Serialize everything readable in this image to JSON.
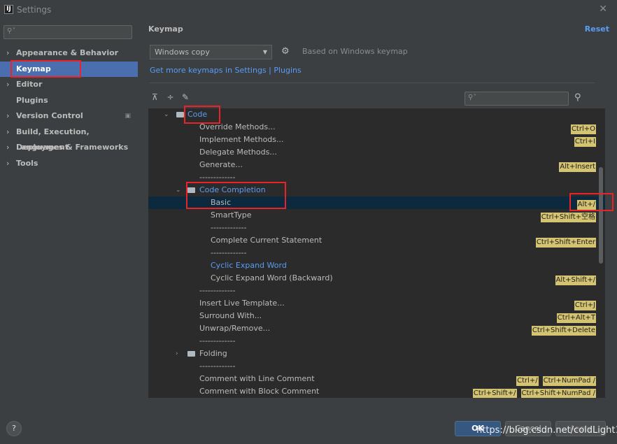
{
  "window": {
    "title": "Settings",
    "logo_letter": "IJ"
  },
  "sidebar": {
    "items": [
      {
        "label": "Appearance & Behavior",
        "expandable": true
      },
      {
        "label": "Keymap",
        "expandable": false
      },
      {
        "label": "Editor",
        "expandable": true
      },
      {
        "label": "Plugins",
        "expandable": false
      },
      {
        "label": "Version Control",
        "expandable": true
      },
      {
        "label": "Build, Execution, Deployment",
        "expandable": true
      },
      {
        "label": "Languages & Frameworks",
        "expandable": true
      },
      {
        "label": "Tools",
        "expandable": true
      }
    ]
  },
  "header": {
    "title": "Keymap",
    "reset": "Reset"
  },
  "keymap": {
    "selected": "Windows copy",
    "based_on": "Based on Windows keymap",
    "more_link": "Get more keymaps in Settings | Plugins"
  },
  "tree": {
    "separator": "-------------",
    "rows": {
      "code": "Code",
      "override": {
        "label": "Override Methods...",
        "shortcuts": [
          "Ctrl+O"
        ]
      },
      "implement": {
        "label": "Implement Methods...",
        "shortcuts": [
          "Ctrl+I"
        ]
      },
      "delegate": {
        "label": "Delegate Methods..."
      },
      "generate": {
        "label": "Generate...",
        "shortcuts": [
          "Alt+Insert"
        ]
      },
      "code_completion": "Code Completion",
      "basic": {
        "label": "Basic",
        "shortcuts": [
          "Alt+/"
        ]
      },
      "smarttype": {
        "label": "SmartType",
        "shortcuts": [
          "Ctrl+Shift+空格"
        ]
      },
      "complete_stmt": {
        "label": "Complete Current Statement",
        "shortcuts": [
          "Ctrl+Shift+Enter"
        ]
      },
      "cyclic": {
        "label": "Cyclic Expand Word"
      },
      "cyclic_back": {
        "label": "Cyclic Expand Word (Backward)",
        "shortcuts": [
          "Alt+Shift+/"
        ]
      },
      "live_template": {
        "label": "Insert Live Template...",
        "shortcuts": [
          "Ctrl+J"
        ]
      },
      "surround": {
        "label": "Surround With...",
        "shortcuts": [
          "Ctrl+Alt+T"
        ]
      },
      "unwrap": {
        "label": "Unwrap/Remove...",
        "shortcuts": [
          "Ctrl+Shift+Delete"
        ]
      },
      "folding": "Folding",
      "line_comment": {
        "label": "Comment with Line Comment",
        "shortcuts": [
          "Ctrl+/",
          "Ctrl+NumPad /"
        ]
      },
      "block_comment": {
        "label": "Comment with Block Comment",
        "shortcuts": [
          "Ctrl+Shift+/",
          "Ctrl+Shift+NumPad /"
        ]
      }
    }
  },
  "buttons": {
    "help": "?",
    "ok": "OK",
    "cancel": "Cancel",
    "apply": "Apply"
  },
  "watermark": "https://blog.csdn.net/coldLight1",
  "colors": {
    "accent": "#589df6",
    "selection": "#4b6eaf",
    "highlight_box": "#e8242a",
    "shortcut_bg": "#d4c472"
  }
}
